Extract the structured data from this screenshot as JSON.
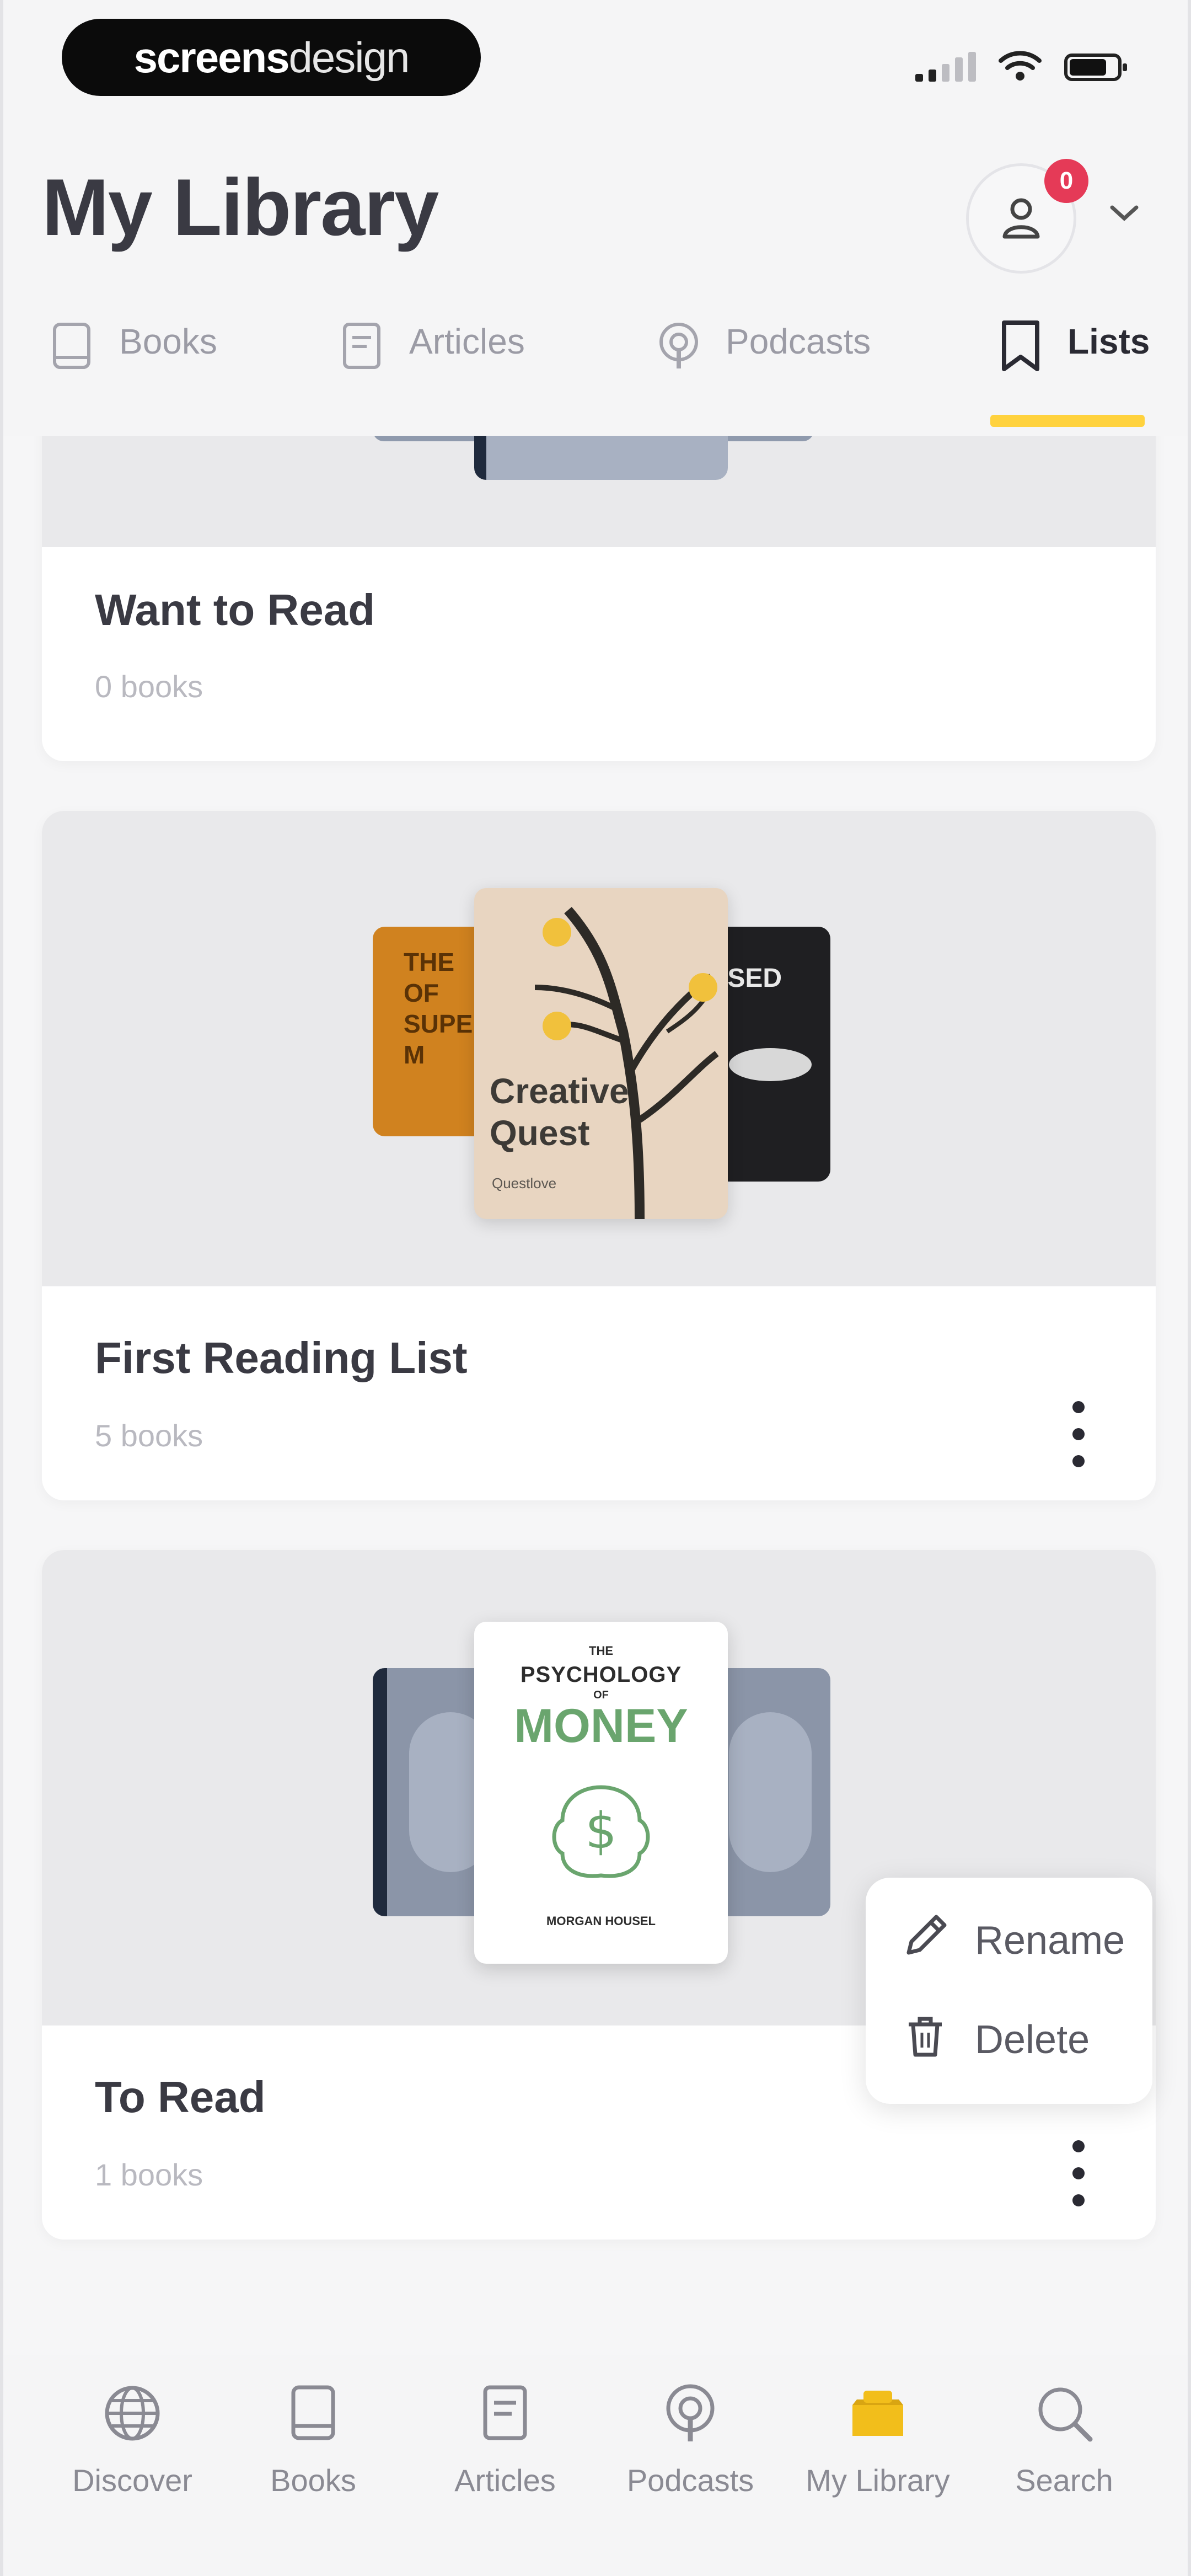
{
  "status_bar": {
    "brand_bold": "screens",
    "brand_light": "design"
  },
  "header": {
    "title": "My Library",
    "notification_count": "0",
    "tabs": [
      {
        "label": "Books",
        "icon": "book-icon"
      },
      {
        "label": "Articles",
        "icon": "article-icon"
      },
      {
        "label": "Podcasts",
        "icon": "podcast-icon"
      },
      {
        "label": "Lists",
        "icon": "bookmark-icon",
        "active": true
      }
    ]
  },
  "lists": [
    {
      "name": "Want to Read",
      "count": "0 books"
    },
    {
      "name": "First Reading List",
      "count": "5 books",
      "covers": {
        "left_text": "THE\nOF\nSUPE\nM",
        "center_title": "Creative\nQuest",
        "center_author": "Questlove",
        "right_text": "ISED"
      }
    },
    {
      "name": "To Read",
      "count": "1 books",
      "covers": {
        "center_pre": "THE",
        "center_title1": "PSYCHOLOGY",
        "center_of": "OF",
        "center_title2": "MONEY",
        "center_author": "MORGAN HOUSEL"
      }
    }
  ],
  "popup_menu": {
    "rename": "Rename",
    "delete": "Delete"
  },
  "bottom_nav": [
    {
      "label": "Discover",
      "icon": "globe-icon"
    },
    {
      "label": "Books",
      "icon": "book-icon"
    },
    {
      "label": "Articles",
      "icon": "article-icon"
    },
    {
      "label": "Podcasts",
      "icon": "podcast-icon"
    },
    {
      "label": "My Library",
      "icon": "library-icon",
      "active": true
    },
    {
      "label": "Search",
      "icon": "search-icon"
    }
  ],
  "colors": {
    "accent": "#ffd23e",
    "badge": "#e53a57",
    "card_bg": "#ffffff",
    "cover_area": "#e9e9eb"
  }
}
